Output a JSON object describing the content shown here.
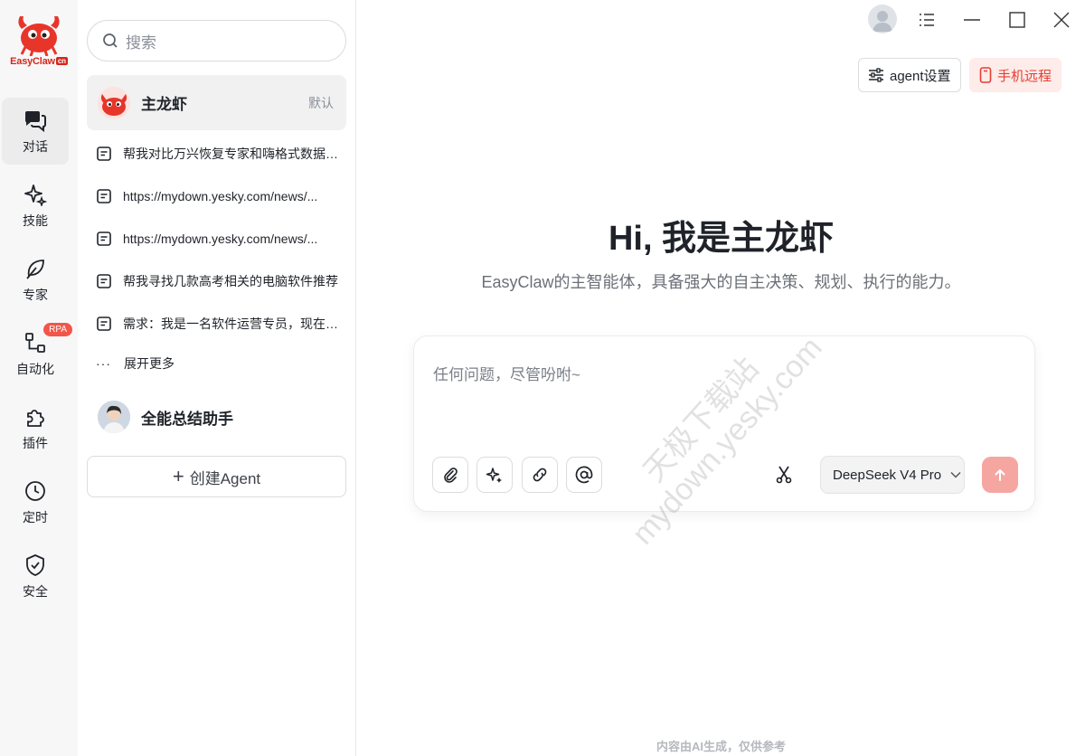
{
  "brand": {
    "name": "EasyClaw",
    "suffix": "cn"
  },
  "rail": {
    "items": [
      {
        "label": "对话",
        "icon": "chat-icon",
        "active": true
      },
      {
        "label": "技能",
        "icon": "sparkle-icon"
      },
      {
        "label": "专家",
        "icon": "leaf-icon"
      },
      {
        "label": "自动化",
        "icon": "flow-icon",
        "badge": "RPA"
      },
      {
        "label": "插件",
        "icon": "puzzle-icon"
      },
      {
        "label": "定时",
        "icon": "clock-icon"
      },
      {
        "label": "安全",
        "icon": "shield-check-icon"
      }
    ]
  },
  "sidebar": {
    "search_placeholder": "搜索",
    "main_agent": {
      "name": "主龙虾",
      "tag": "默认"
    },
    "conversations": [
      "帮我对比万兴恢复专家和嗨格式数据恢复大师",
      "https://mydown.yesky.com/news/...",
      "https://mydown.yesky.com/news/...",
      "帮我寻找几款高考相关的电脑软件推荐",
      "需求：我是一名软件运营专员，现在需要"
    ],
    "expand_label": "展开更多",
    "second_agent": {
      "name": "全能总结助手"
    },
    "create_agent_label": "创建Agent"
  },
  "header": {
    "agent_settings_label": "agent设置",
    "mobile_remote_label": "手机远程"
  },
  "hero": {
    "title": "Hi, 我是主龙虾",
    "subtitle": "EasyClaw的主智能体，具备强大的自主决策、规划、执行的能力。"
  },
  "composer": {
    "placeholder": "任何问题，尽管吩咐~",
    "model": "DeepSeek V4 Pro",
    "tools": [
      "attach-icon",
      "magic-icon",
      "link-icon",
      "at-icon",
      "scissors-icon"
    ]
  },
  "watermark": {
    "line1": "天极下载站",
    "line2": "mydown.yesky.com"
  },
  "footer_note": "内容由AI生成，仅供参考",
  "colors": {
    "accent": "#e53e30",
    "send_disabled": "#f6a6a0",
    "rail_bg": "#f7f7f8"
  }
}
